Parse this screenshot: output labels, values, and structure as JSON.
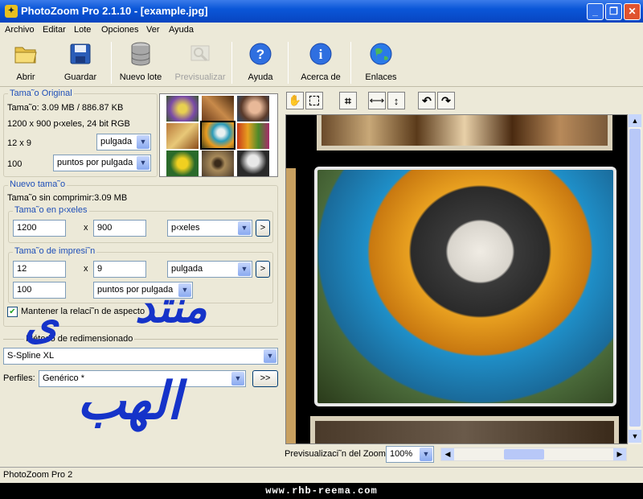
{
  "window": {
    "title": "PhotoZoom Pro 2.1.10 - [example.jpg]",
    "controls": [
      "_",
      "❐",
      "✕"
    ]
  },
  "menu": [
    "Archivo",
    "Editar",
    "Lote",
    "Opciones",
    "Ver",
    "Ayuda"
  ],
  "toolbar": {
    "open": "Abrir",
    "save": "Guardar",
    "batch": "Nuevo lote",
    "preview": "Previsualizar",
    "help": "Ayuda",
    "about": "Acerca de",
    "links": "Enlaces"
  },
  "original": {
    "group_label": "Tama˜o Original",
    "size_line": "Tama˜o: 3.09 MB / 886.87 KB",
    "dims_line": "1200 x 900 p‹xeles, 24 bit RGB",
    "print_size": "12 x 9",
    "unit": "pulgada",
    "resolution": "100",
    "res_unit": "puntos por pulgada"
  },
  "new_size": {
    "group_label": "Nuevo tama˜o",
    "uncompressed": "Tama˜o sin comprimir:3.09 MB",
    "pixels_label": "Tama˜o en p‹xeles",
    "px_width": "1200",
    "px_height": "900",
    "px_unit": "p‹xeles",
    "print_label": "Tama˜o de impresi˜n",
    "print_width": "12",
    "print_height": "9",
    "print_unit": "pulgada",
    "resolution": "100",
    "res_unit": "puntos por pulgada",
    "x": "x",
    "more": ">",
    "keep_aspect": "Mantener la relaci˜n de aspecto"
  },
  "method": {
    "label": "Método de redimensionado",
    "value": "S-Spline XL"
  },
  "profiles": {
    "label": "Perfiles:",
    "value": "Genérico *",
    "button": ">>"
  },
  "zoom": {
    "label": "Previsualizaci˜n del Zoom:",
    "value": "100%"
  },
  "status": "PhotoZoom Pro 2",
  "footer": "www.rhb-reema.com",
  "watermark": {
    "word1": "منتد",
    "word2": "ى",
    "word3": "الهب"
  },
  "colors": {
    "title_blue": "#0a56d8",
    "group_label": "#1f4fb8",
    "watermark": "#1533c9"
  }
}
